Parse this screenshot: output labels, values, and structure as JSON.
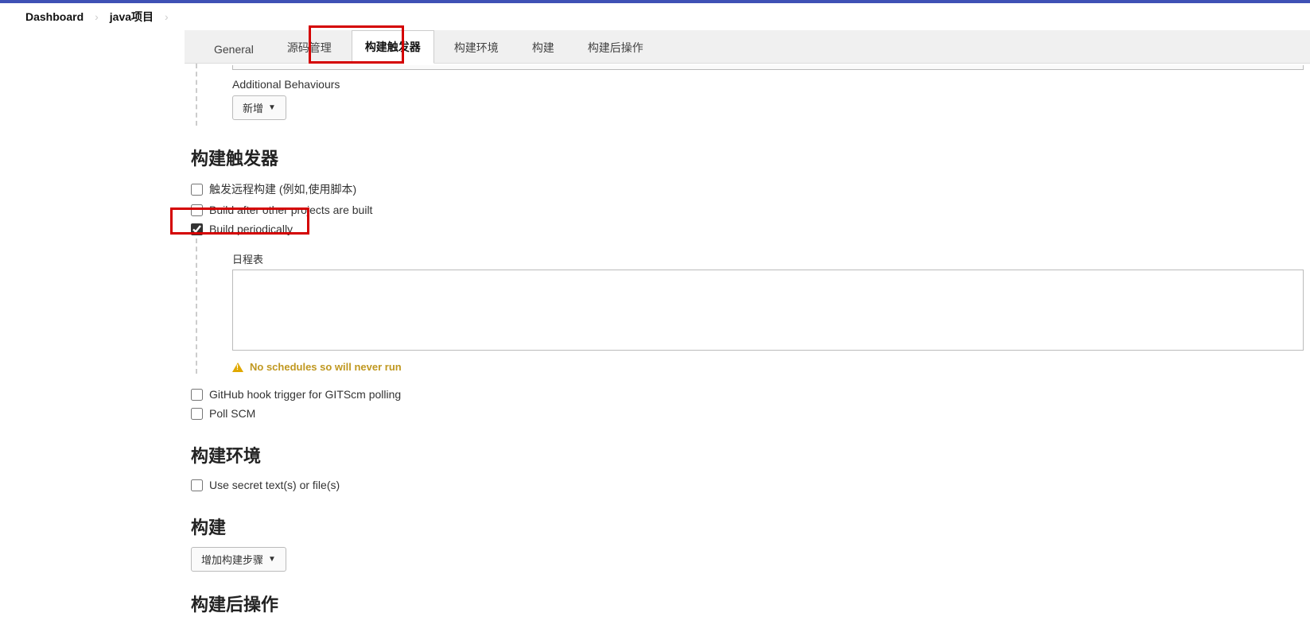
{
  "breadcrumb": {
    "dashboard": "Dashboard",
    "project": "java项目"
  },
  "tabs": {
    "general": "General",
    "scm": "源码管理",
    "triggers": "构建触发器",
    "env": "构建环境",
    "build": "构建",
    "post": "构建后操作"
  },
  "scm_section": {
    "additional_behaviours": "Additional Behaviours",
    "add_button": "新增"
  },
  "triggers_section": {
    "title": "构建触发器",
    "remote": "触发远程构建 (例如,使用脚本)",
    "after_other": "Build after other projects are built",
    "periodically": "Build periodically",
    "schedule_label": "日程表",
    "warning": "No schedules so will never run",
    "github_hook": "GitHub hook trigger for GITScm polling",
    "poll_scm": "Poll SCM"
  },
  "env_section": {
    "title": "构建环境",
    "secret": "Use secret text(s) or file(s)"
  },
  "build_section": {
    "title": "构建",
    "add_step": "增加构建步骤"
  },
  "post_section": {
    "title": "构建后操作"
  }
}
